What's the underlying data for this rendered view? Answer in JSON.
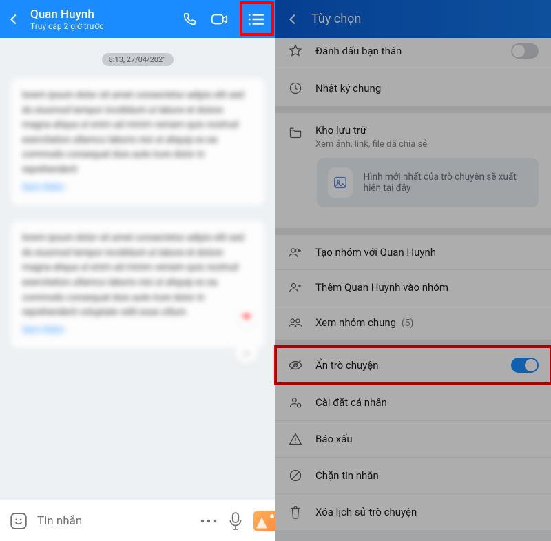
{
  "left": {
    "contact_name": "Quan Huynh",
    "last_seen": "Truy cập 2 giờ trước",
    "timestamp": "8:13, 27/04/2021",
    "input_placeholder": "Tin nhắn",
    "bubble1_text": "lorem ipsum dolor sit amet consectetur adipis elit sed do eiusmod tempor incididunt ut labore et dolore magna aliqua ut enim ad minim veniam quis nostrud exercitation ullamco laboris nisi ut aliquip ex ea commodo consequat duis aute irure dolor in reprehenderit",
    "bubble1_link": "Xem thêm",
    "bubble2_text": "lorem ipsum dolor sit amet consectetur adipis elit sed do eiusmod tempor incididunt ut labore et dolore magna aliqua ut enim ad minim veniam quis nostrud exercitation ullamco laboris nisi ut aliquip ex ea commodo consequat duis aute irure dolor in reprehenderit voluptate velit esse cillum",
    "bubble2_link": "Xem thêm"
  },
  "right": {
    "title": "Tùy chọn",
    "items": {
      "best_friend": "Đánh dấu bạn thân",
      "diary": "Nhật ký chung",
      "storage_title": "Kho lưu trữ",
      "storage_sub": "Xem ảnh, link, file đã chia sẻ",
      "media_hint": "Hình mới nhất của trò chuyện sẽ xuất hiện tại đây",
      "create_group": "Tạo nhóm với Quan Huynh",
      "add_to_group": "Thêm Quan Huynh vào nhóm",
      "common_groups": "Xem nhóm chung",
      "common_groups_count": "(5)",
      "hide_chat": "Ẩn trò chuyện",
      "personal_settings": "Cài đặt cá nhân",
      "report": "Báo xấu",
      "block": "Chặn tin nhắn",
      "delete_history": "Xóa lịch sử trò chuyện"
    }
  }
}
